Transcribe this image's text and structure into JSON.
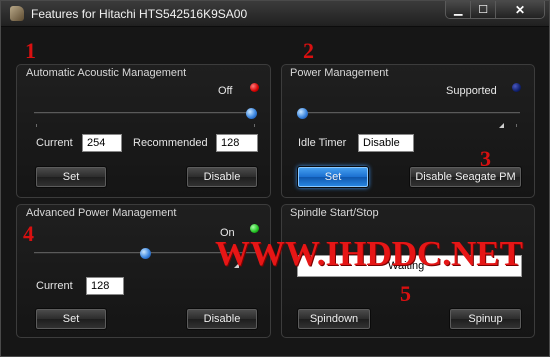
{
  "window": {
    "title": "Features for Hitachi HTS542516K9SA00",
    "controls": {
      "minimize": "▁",
      "maximize": "☐",
      "close": "✕"
    }
  },
  "aam": {
    "title": "Automatic Acoustic Management",
    "status": "Off",
    "status_color": "#d40000",
    "slider_level": 1.0,
    "current_label": "Current",
    "current_value": "254",
    "recommended_label": "Recommended",
    "recommended_value": "128",
    "set_label": "Set",
    "disable_label": "Disable"
  },
  "pm": {
    "title": "Power Management",
    "status": "Supported",
    "status_color": "#10206e",
    "slider_level": 0.0,
    "idle_timer_label": "Idle Timer",
    "idle_timer_value": "Disable",
    "set_label": "Set",
    "disable_seagate_label": "Disable Seagate PM"
  },
  "apm": {
    "title": "Advanced Power Management",
    "status": "On",
    "status_color": "#20c020",
    "slider_level": 0.5,
    "current_label": "Current",
    "current_value": "128",
    "set_label": "Set",
    "disable_label": "Disable"
  },
  "spindle": {
    "title": "Spindle Start/Stop",
    "status_text": "Waiting",
    "spindown_label": "Spindown",
    "spinup_label": "Spinup"
  },
  "annotations": {
    "n1": "1",
    "n2": "2",
    "n3": "3",
    "n4": "4",
    "n5": "5",
    "watermark": "WWW.IHDDC.NET"
  },
  "colors": {
    "annotation_red": "#d81010",
    "slider_knob": "#3b86e0",
    "active_button": "#1b6fd0"
  }
}
